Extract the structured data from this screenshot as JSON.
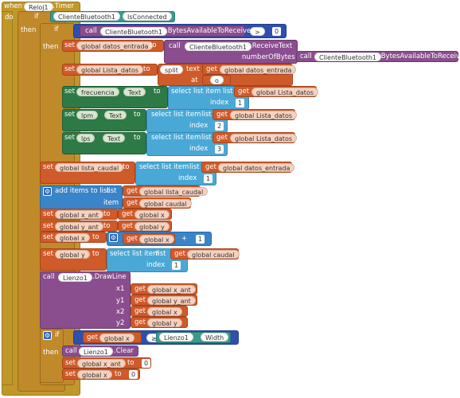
{
  "when_label": "when",
  "timer_component": "Reloj1",
  "timer_event": ".Timer",
  "do_label": "do",
  "if_label": "if",
  "then_label": "then",
  "bt_component": "ClienteBluetooth1",
  "prop_isconnected": "IsConnected",
  "call_label": "call",
  "prop_bytes_available": ".BytesAvailableToReceive",
  "op_gt": ">",
  "zero": "0",
  "set_label": "set",
  "to_label": "to",
  "get_label": "get",
  "var_datos_entrada": "global datos_entrada",
  "method_receive_text": ".ReceiveText",
  "param_number_of_bytes": "numberOfBytes",
  "var_lista_datos": "global Lista_datos",
  "split_label": "split",
  "text_label": "text",
  "at_label": "at",
  "split_at_value": "o",
  "comp_frecuencia": "frecuencia",
  "prop_text": "Text",
  "select_list_item_label": "select list item",
  "list_label": "list",
  "index_label": "index",
  "idx1": "1",
  "idx2": "2",
  "idx3": "3",
  "comp_lpm": "lpm",
  "comp_lps": "lps",
  "var_lista_caudal": "global lista_caudal",
  "add_items_label": "add items to list",
  "item_label": "item",
  "var_caudal": "global caudal",
  "var_x_ant": "global x_ant",
  "var_x": "global x",
  "var_y_ant": "global y_ant",
  "var_y": "global y",
  "op_plus": "+",
  "canvas_component": "Lienzo1",
  "method_drawline": ".DrawLine",
  "x1_label": "x1",
  "y1_label": "y1",
  "x2_label": "x2",
  "y2_label": "y2",
  "op_gte": "≥",
  "prop_width": "Width",
  "method_clear": ".Clear"
}
